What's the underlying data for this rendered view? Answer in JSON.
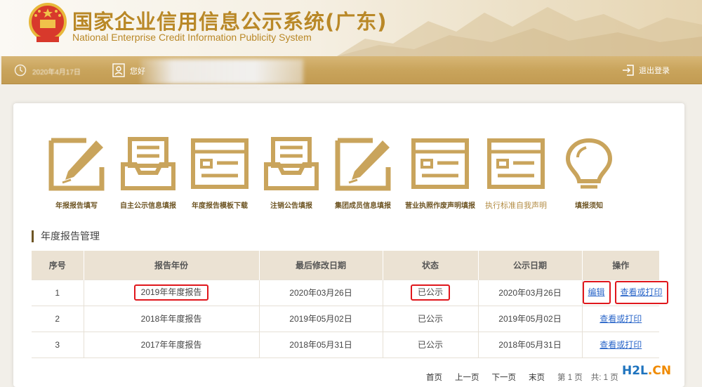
{
  "header": {
    "title_cn": "国家企业信用信息公示系统(广东)",
    "title_en": "National Enterprise Credit Information Publicity System"
  },
  "topbar": {
    "date": "2020年4月17日",
    "greeting": "您好",
    "logout_label": "退出登录"
  },
  "tiles": [
    {
      "label": "年报报告填写",
      "icon": "pencil-form-icon"
    },
    {
      "label": "自主公示信息填报",
      "icon": "inbox-tray-icon"
    },
    {
      "label": "年度报告模板下载",
      "icon": "template-doc-icon"
    },
    {
      "label": "注销公告填报",
      "icon": "inbox-tray-icon"
    },
    {
      "label": "集团成员信息填报",
      "icon": "pencil-form-icon"
    },
    {
      "label": "营业执照作废声明填报",
      "icon": "template-doc-icon"
    },
    {
      "label": "执行标准自我声明",
      "icon": "template-doc-icon"
    },
    {
      "label": "填报须知",
      "icon": "lightbulb-icon"
    }
  ],
  "section_title": "年度报告管理",
  "table": {
    "headers": [
      "序号",
      "报告年份",
      "最后修改日期",
      "状态",
      "公示日期",
      "操作"
    ],
    "rows": [
      {
        "no": "1",
        "year": "2019年年度报告",
        "modified": "2020年03月26日",
        "status": "已公示",
        "published": "2020年03月26日",
        "edit": "编辑",
        "view": "查看或打印"
      },
      {
        "no": "2",
        "year": "2018年年度报告",
        "modified": "2019年05月02日",
        "status": "已公示",
        "published": "2019年05月02日",
        "view": "查看或打印"
      },
      {
        "no": "3",
        "year": "2017年年度报告",
        "modified": "2018年05月31日",
        "status": "已公示",
        "published": "2018年05月31日",
        "view": "查看或打印"
      }
    ]
  },
  "pager": {
    "first": "首页",
    "prev": "上一页",
    "next": "下一页",
    "last": "末页",
    "current": "第 1 页",
    "total": "共: 1 页"
  },
  "watermark": {
    "part1": "H2L",
    "part2": ".CN"
  },
  "colors": {
    "gold": "#c9a45c",
    "tile_gold": "#c9a45c",
    "link": "#2a66c9",
    "highlight": "#e0171c"
  }
}
